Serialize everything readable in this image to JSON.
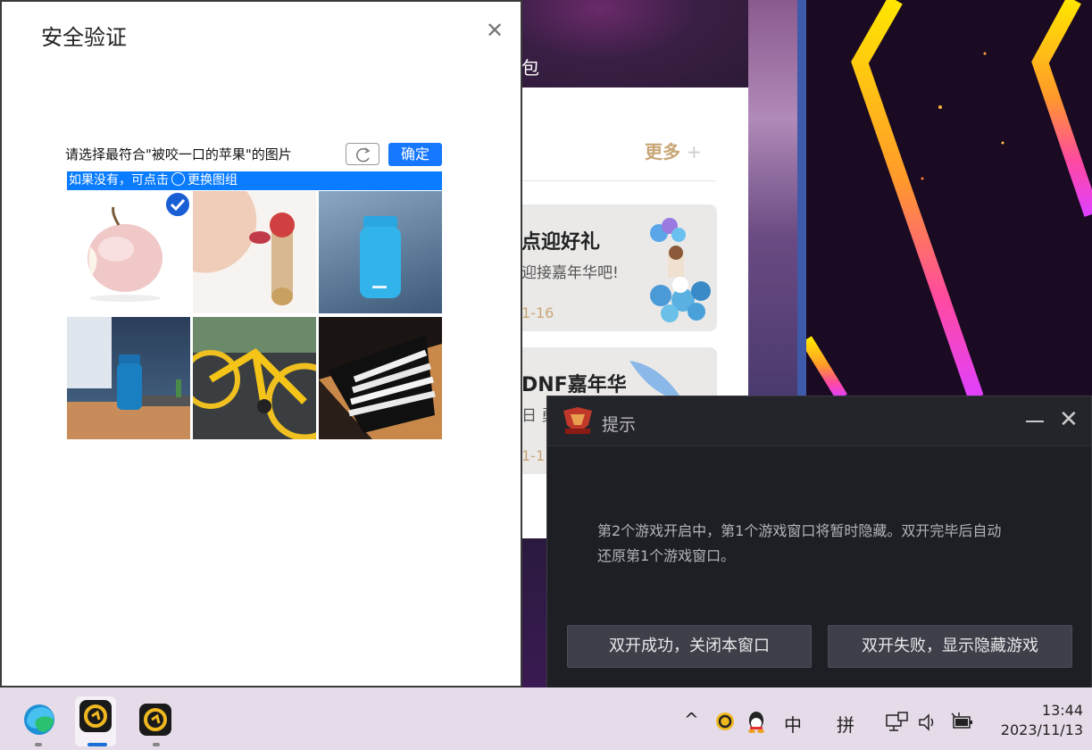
{
  "background": {
    "hero_text": "包",
    "more_label": "更多",
    "more_icon": "plus-icon",
    "cards": [
      {
        "title": "点迎好礼",
        "subtitle": "迎接嘉年华吧!",
        "date": "1-16"
      },
      {
        "title": "DNF嘉年华",
        "subtitle": "日 勇",
        "date": "1-1"
      }
    ]
  },
  "security_dialog": {
    "title": "安全验证",
    "close_icon": "close-icon",
    "prompt": "请选择最符合\"被咬一口的苹果\"的图片",
    "refresh_icon": "refresh-icon",
    "confirm_label": "确定",
    "hint_before": "如果没有，可点击",
    "hint_after": "更换图组",
    "tiles": [
      {
        "name": "bitten-apple",
        "selected": true
      },
      {
        "name": "person-eating-apple",
        "selected": false
      },
      {
        "name": "blue-bottle",
        "selected": false
      },
      {
        "name": "blue-bottle-on-desk",
        "selected": false
      },
      {
        "name": "yellow-bicycle",
        "selected": false
      },
      {
        "name": "pencils-in-drawer",
        "selected": false
      }
    ]
  },
  "tip_dialog": {
    "title": "提示",
    "minimize_icon": "minimize-icon",
    "close_icon": "close-icon",
    "message_line1": "第2个游戏开启中，第1个游戏窗口将暂时隐藏。双开完毕后自动",
    "message_line2": "还原第1个游戏窗口。",
    "button_success": "双开成功，关闭本窗口",
    "button_fail": "双开失败，显示隐藏游戏"
  },
  "taskbar": {
    "apps": [
      "edge-icon",
      "game-launcher-icon",
      "game-launcher-icon"
    ],
    "tray": {
      "chevron": "^",
      "ime_mode": "中",
      "ime_layout": "拼",
      "time": "13:44",
      "date": "2023/11/13"
    }
  },
  "colors": {
    "confirm_blue": "#1677ff",
    "hint_blue": "#0a7cff",
    "check_blue": "#1a5ed6",
    "gold": "#c8a676",
    "tip_bg": "#1e1f24"
  }
}
